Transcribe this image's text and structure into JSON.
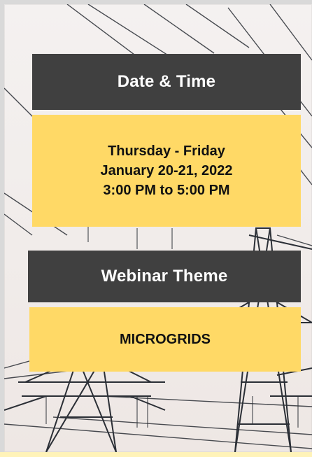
{
  "date_time": {
    "heading": "Date & Time",
    "days": "Thursday - Friday",
    "dates": "January 20-21, 2022",
    "time": "3:00 PM to 5:00 PM"
  },
  "webinar": {
    "heading": "Webinar Theme",
    "theme": "MICROGRIDS"
  },
  "colors": {
    "dark_card": "#404040",
    "yellow_card": "#ffd966",
    "background": "#f4f1f0"
  }
}
